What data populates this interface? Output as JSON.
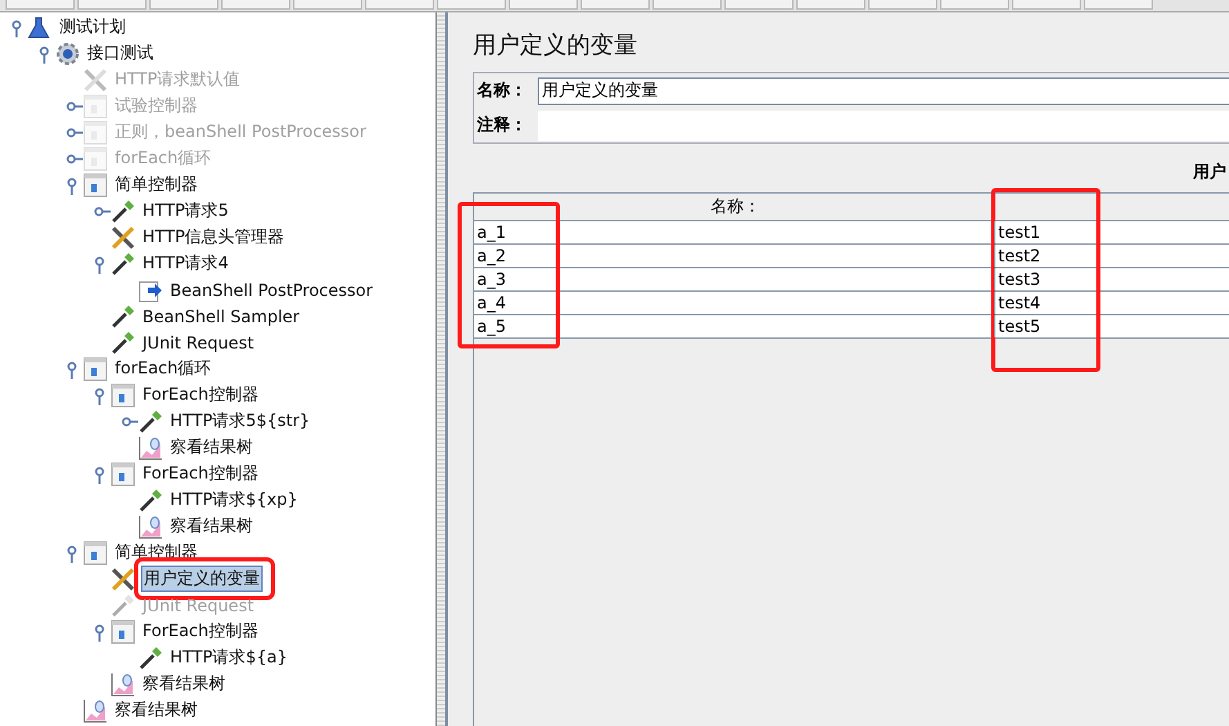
{
  "tree": [
    {
      "label": "测试计划",
      "kind": "plan",
      "disabled": false,
      "selected": false,
      "highlighted": false,
      "expanded": true,
      "children": [
        {
          "label": "接口测试",
          "kind": "thread-group",
          "disabled": false,
          "selected": false,
          "highlighted": false,
          "expanded": true,
          "children": [
            {
              "label": "HTTP请求默认值",
              "kind": "config",
              "disabled": true,
              "selected": false,
              "highlighted": false
            },
            {
              "label": "试验控制器",
              "kind": "controller",
              "disabled": true,
              "selected": false,
              "highlighted": false,
              "expanded": false
            },
            {
              "label": "正则，beanShell PostProcessor",
              "kind": "controller",
              "disabled": true,
              "selected": false,
              "highlighted": false,
              "expanded": false
            },
            {
              "label": "forEach循环",
              "kind": "controller",
              "disabled": true,
              "selected": false,
              "highlighted": false,
              "expanded": false
            },
            {
              "label": "简单控制器",
              "kind": "controller",
              "disabled": false,
              "selected": false,
              "highlighted": false,
              "expanded": true,
              "children": [
                {
                  "label": "HTTP请求5",
                  "kind": "sampler",
                  "disabled": false,
                  "selected": false,
                  "highlighted": false,
                  "expanded": false
                },
                {
                  "label": "HTTP信息头管理器",
                  "kind": "config",
                  "disabled": false,
                  "selected": false,
                  "highlighted": false
                },
                {
                  "label": "HTTP请求4",
                  "kind": "sampler",
                  "disabled": false,
                  "selected": false,
                  "highlighted": false,
                  "expanded": true,
                  "children": [
                    {
                      "label": "BeanShell PostProcessor",
                      "kind": "postprocessor",
                      "disabled": false,
                      "selected": false,
                      "highlighted": false
                    }
                  ]
                },
                {
                  "label": "BeanShell Sampler",
                  "kind": "sampler",
                  "disabled": false,
                  "selected": false,
                  "highlighted": false
                },
                {
                  "label": "JUnit Request",
                  "kind": "sampler",
                  "disabled": false,
                  "selected": false,
                  "highlighted": false
                }
              ]
            },
            {
              "label": "forEach循环",
              "kind": "controller",
              "disabled": false,
              "selected": false,
              "highlighted": false,
              "expanded": true,
              "children": [
                {
                  "label": "ForEach控制器",
                  "kind": "controller",
                  "disabled": false,
                  "selected": false,
                  "highlighted": false,
                  "expanded": true,
                  "children": [
                    {
                      "label": "HTTP请求5${str}",
                      "kind": "sampler",
                      "disabled": false,
                      "selected": false,
                      "highlighted": false,
                      "expanded": false
                    },
                    {
                      "label": "察看结果树",
                      "kind": "listener",
                      "disabled": false,
                      "selected": false,
                      "highlighted": false
                    }
                  ]
                },
                {
                  "label": "ForEach控制器",
                  "kind": "controller",
                  "disabled": false,
                  "selected": false,
                  "highlighted": false,
                  "expanded": true,
                  "children": [
                    {
                      "label": "HTTP请求${xp}",
                      "kind": "sampler",
                      "disabled": false,
                      "selected": false,
                      "highlighted": false
                    },
                    {
                      "label": "察看结果树",
                      "kind": "listener",
                      "disabled": false,
                      "selected": false,
                      "highlighted": false
                    }
                  ]
                }
              ]
            },
            {
              "label": "简单控制器",
              "kind": "controller",
              "disabled": false,
              "selected": false,
              "highlighted": false,
              "expanded": true,
              "children": [
                {
                  "label": "用户定义的变量",
                  "kind": "config",
                  "disabled": false,
                  "selected": true,
                  "highlighted": true
                },
                {
                  "label": "JUnit Request",
                  "kind": "sampler",
                  "disabled": true,
                  "selected": false,
                  "highlighted": false
                },
                {
                  "label": "ForEach控制器",
                  "kind": "controller",
                  "disabled": false,
                  "selected": false,
                  "highlighted": false,
                  "expanded": true,
                  "children": [
                    {
                      "label": "HTTP请求${a}",
                      "kind": "sampler",
                      "disabled": false,
                      "selected": false,
                      "highlighted": false
                    }
                  ]
                },
                {
                  "label": "察看结果树",
                  "kind": "listener",
                  "disabled": false,
                  "selected": false,
                  "highlighted": false
                }
              ]
            },
            {
              "label": "察看结果树",
              "kind": "listener",
              "disabled": false,
              "selected": false,
              "highlighted": false
            }
          ]
        }
      ]
    }
  ],
  "panel": {
    "title": "用户定义的变量",
    "name_label": "名称：",
    "name_value": "用户定义的变量",
    "comment_label": "注释：",
    "section_title": "用户",
    "table": {
      "columns": [
        {
          "label": "名称：",
          "highlighted": true
        },
        {
          "highlighted": true
        }
      ],
      "rows": [
        [
          "a_1",
          "test1"
        ],
        [
          "a_2",
          "test2"
        ],
        [
          "a_3",
          "test3"
        ],
        [
          "a_4",
          "test4"
        ],
        [
          "a_5",
          "test5"
        ]
      ]
    }
  }
}
